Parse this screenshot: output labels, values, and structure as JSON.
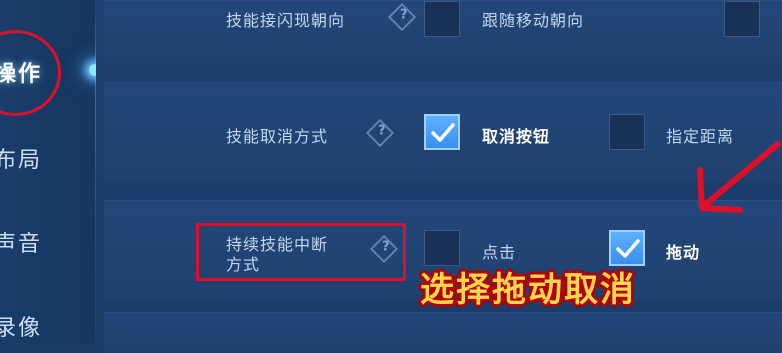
{
  "sidebar": {
    "items": [
      {
        "label": "操作",
        "active": true
      },
      {
        "label": "布局",
        "active": false
      },
      {
        "label": "声音",
        "active": false
      },
      {
        "label": "录像",
        "active": false
      }
    ]
  },
  "settings": {
    "row1": {
      "label": "技能接闪现朝向",
      "option": "跟随移动朝向"
    },
    "row2": {
      "label": "技能取消方式",
      "option_a": "取消按钮",
      "option_a_checked": true,
      "option_b": "指定距离",
      "option_b_checked": false
    },
    "row3": {
      "label_line1": "持续技能中断",
      "label_line2": "方式",
      "option_a": "点击",
      "option_a_checked": false,
      "option_b": "拖动",
      "option_b_checked": true
    }
  },
  "overlay": {
    "caption": "选择拖动取消",
    "highlight_color": "#e0102a",
    "caption_color": "#ffd74a"
  },
  "icons": {
    "help": "?",
    "check": "check-icon"
  }
}
